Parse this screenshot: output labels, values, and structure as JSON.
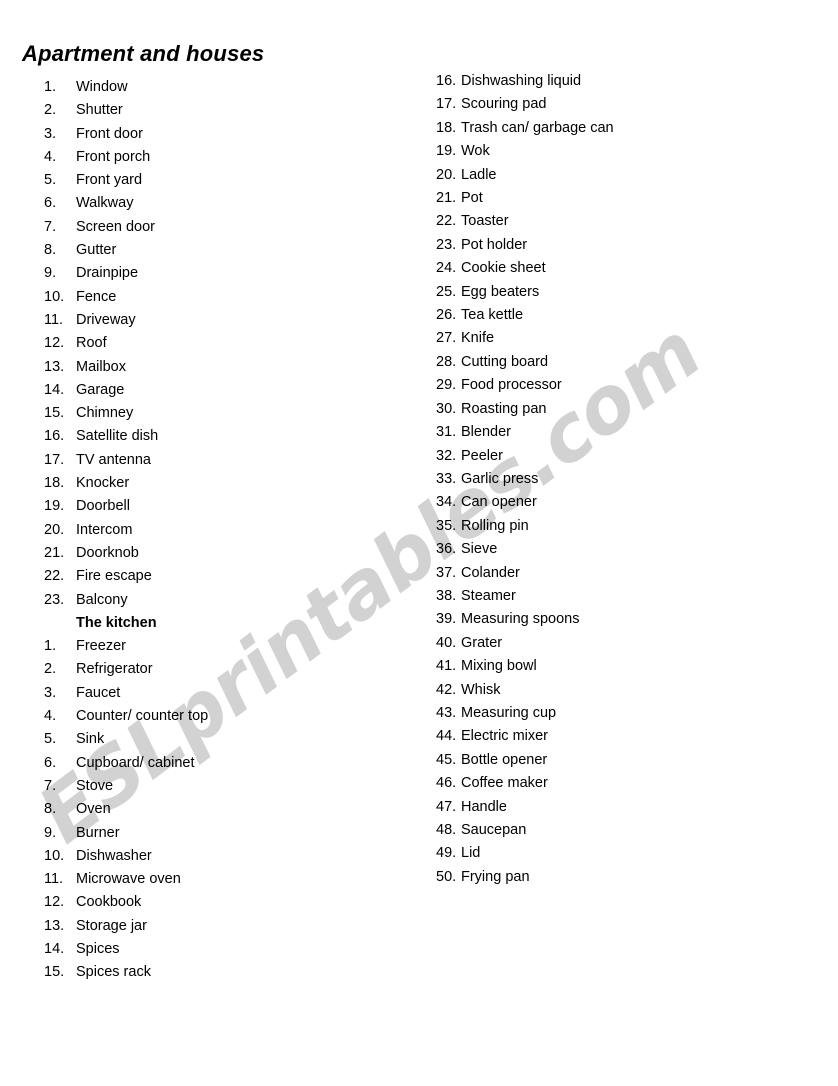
{
  "document": {
    "title": "Apartment and houses",
    "watermark": "ESLprintables.com",
    "watermark_color": "#d2d2d2",
    "background_color": "#ffffff",
    "text_color": "#000000"
  },
  "sections": [
    {
      "id": "apartment-and-houses",
      "heading": "",
      "items": [
        "Window",
        "Shutter",
        "Front door",
        "Front porch",
        "Front yard",
        "Walkway",
        "Screen door",
        "Gutter",
        "Drainpipe",
        "Fence",
        "Driveway",
        "Roof",
        "Mailbox",
        "Garage",
        "Chimney",
        "Satellite dish",
        "TV antenna",
        "Knocker",
        "Doorbell",
        "Intercom",
        "Doorknob",
        "Fire escape",
        "Balcony"
      ]
    },
    {
      "id": "the-kitchen",
      "heading": "The kitchen",
      "items": [
        "Freezer",
        "Refrigerator",
        "Faucet",
        "Counter/ counter top",
        "Sink",
        "Cupboard/ cabinet",
        "Stove",
        "Oven",
        "Burner",
        "Dishwasher",
        "Microwave oven",
        "Cookbook",
        "Storage jar",
        "Spices",
        "Spices rack",
        "Dishwashing liquid",
        "Scouring pad",
        "Trash can/ garbage can",
        "Wok",
        "Ladle",
        "Pot",
        "Toaster",
        "Pot holder",
        "Cookie sheet",
        "Egg beaters",
        "Tea kettle",
        "Knife",
        "Cutting board",
        "Food processor",
        "Roasting pan",
        "Blender",
        "Peeler",
        "Garlic press",
        "Can opener",
        "Rolling pin",
        "Sieve",
        "Colander",
        "Steamer",
        "Measuring spoons",
        "Grater",
        "Mixing bowl",
        "Whisk",
        "Measuring cup",
        "Electric mixer",
        "Bottle opener",
        "Coffee maker",
        "Handle",
        "Saucepan",
        "Lid",
        "Frying pan"
      ]
    }
  ],
  "layout": {
    "left_column": {
      "house_items_start": 1,
      "house_items_end": 23,
      "kitchen_items_start": 1,
      "kitchen_items_end": 15
    },
    "right_column": {
      "kitchen_items_start": 16,
      "kitchen_items_end": 50
    }
  }
}
